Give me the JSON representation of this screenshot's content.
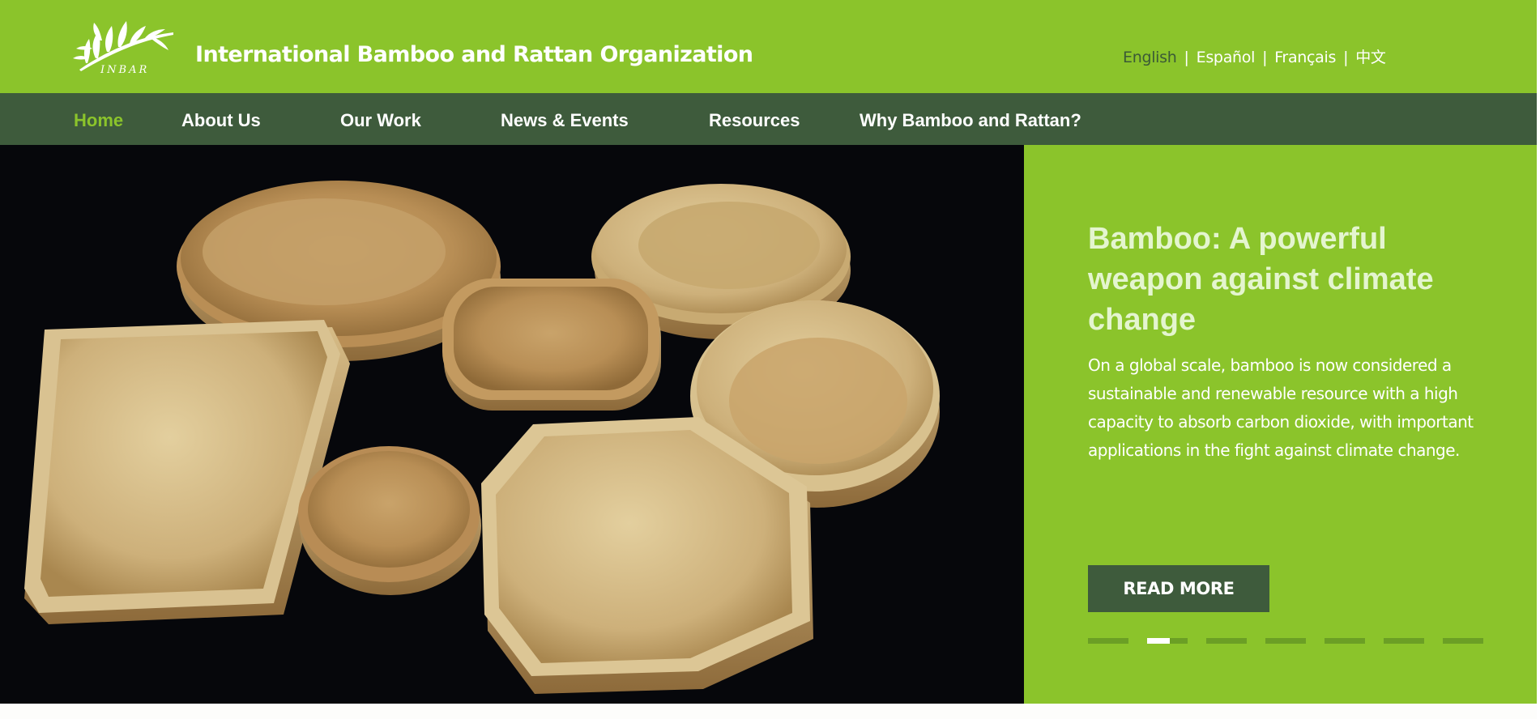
{
  "header": {
    "org_title": "International Bamboo and Rattan Organization",
    "logo_text": "INBAR",
    "languages": [
      {
        "label": "English",
        "active": true
      },
      {
        "label": "Español",
        "active": false
      },
      {
        "label": "Français",
        "active": false
      },
      {
        "label": "中文",
        "active": false
      }
    ],
    "separator": "|"
  },
  "nav": {
    "items": [
      {
        "label": "Home",
        "active": true
      },
      {
        "label": "About Us",
        "active": false
      },
      {
        "label": "Our Work",
        "active": false
      },
      {
        "label": "News & Events",
        "active": false
      },
      {
        "label": "Resources",
        "active": false
      },
      {
        "label": "Why Bamboo and Rattan?",
        "active": false
      }
    ]
  },
  "hero": {
    "title": "Bamboo: A powerful weapon against climate change",
    "text": "On a global scale, bamboo is now considered a sustainable and renewable resource with a high capacity to absorb carbon dioxide, with important applications in the fight against climate change.",
    "button_label": "READ MORE",
    "slide_count": 7,
    "active_slide": 2
  },
  "colors": {
    "brand_green": "#8bc42b",
    "nav_dark_green": "#3e5b3c",
    "hero_image_bg": "#06070b"
  }
}
